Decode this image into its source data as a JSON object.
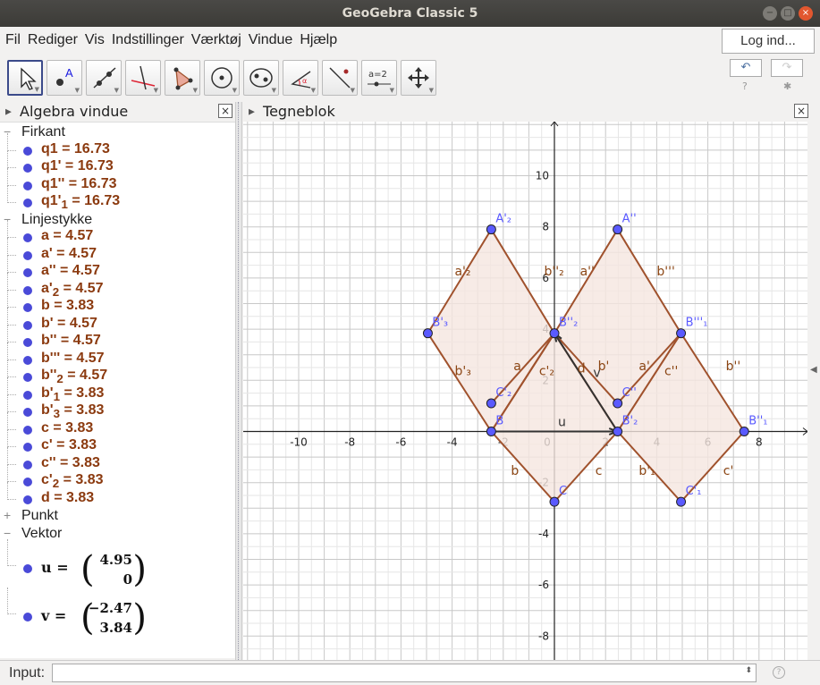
{
  "window": {
    "title": "GeoGebra Classic 5"
  },
  "menu": {
    "items": [
      "Fil",
      "Rediger",
      "Vis",
      "Indstillinger",
      "Værktøj",
      "Vindue",
      "Hjælp"
    ],
    "login": "Log ind..."
  },
  "toolbar": {
    "tools": [
      "move-tool",
      "point-tool",
      "line-tool",
      "perpendicular-tool",
      "polygon-tool",
      "circle-tool",
      "ellipse-tool",
      "angle-tool",
      "reflect-tool",
      "slider-tool",
      "move-view-tool"
    ],
    "slider_label": "a=2"
  },
  "algebra": {
    "title": "Algebra vindue",
    "categories": [
      {
        "name": "Firkant",
        "items": [
          {
            "html": "q1 = 16.73"
          },
          {
            "html": "q1' = 16.73"
          },
          {
            "html": "q1'' = 16.73"
          },
          {
            "html": "q1'<sub>1</sub> = 16.73"
          }
        ]
      },
      {
        "name": "Linjestykke",
        "items": [
          {
            "html": "a = 4.57"
          },
          {
            "html": "a' = 4.57"
          },
          {
            "html": "a'' = 4.57"
          },
          {
            "html": "a'<sub>2</sub> = 4.57"
          },
          {
            "html": "b = 3.83"
          },
          {
            "html": "b' = 4.57"
          },
          {
            "html": "b'' = 4.57"
          },
          {
            "html": "b''' = 4.57"
          },
          {
            "html": "b''<sub>2</sub> = 4.57"
          },
          {
            "html": "b'<sub>1</sub> = 3.83"
          },
          {
            "html": "b'<sub>3</sub> = 3.83"
          },
          {
            "html": "c = 3.83"
          },
          {
            "html": "c' = 3.83"
          },
          {
            "html": "c'' = 3.83"
          },
          {
            "html": "c'<sub>2</sub> = 3.83"
          },
          {
            "html": "d = 3.83"
          }
        ]
      },
      {
        "name": "Punkt",
        "items": []
      },
      {
        "name": "Vektor",
        "items": []
      }
    ],
    "vectors": [
      {
        "name": "u",
        "x": "4.95",
        "y": "0"
      },
      {
        "name": "v",
        "x": "−2.47",
        "y": "3.84"
      }
    ]
  },
  "graphics": {
    "title": "Tegneblok",
    "x_ticks": [
      -10,
      -8,
      -6,
      -4,
      -2,
      0,
      2,
      4,
      6,
      8
    ],
    "y_ticks": [
      -8,
      -6,
      -4,
      -2,
      2,
      4,
      6,
      8,
      10
    ],
    "fill_color": "#f5e6e0",
    "edge_color": "#a0522d",
    "point_color": "#5a5aff",
    "polygons": [
      [
        [
          -2.47,
          0
        ],
        [
          0,
          -2.75
        ],
        [
          2.47,
          0
        ],
        [
          0,
          3.84
        ]
      ],
      [
        [
          -2.47,
          0
        ],
        [
          0,
          3.84
        ],
        [
          -2.47,
          7.9
        ],
        [
          -4.95,
          3.84
        ]
      ],
      [
        [
          2.47,
          0
        ],
        [
          4.95,
          3.84
        ],
        [
          2.47,
          7.9
        ],
        [
          0,
          3.84
        ]
      ],
      [
        [
          2.47,
          0
        ],
        [
          4.95,
          -2.75
        ],
        [
          7.42,
          0
        ],
        [
          4.95,
          3.84
        ]
      ]
    ],
    "segments": [
      [
        [
          -2.47,
          0
        ],
        [
          0,
          3.84
        ]
      ],
      [
        [
          -2.47,
          1.1
        ],
        [
          0,
          3.84
        ]
      ],
      [
        [
          2.47,
          1.1
        ],
        [
          0,
          3.84
        ]
      ],
      [
        [
          2.47,
          1.1
        ],
        [
          4.95,
          3.84
        ]
      ]
    ],
    "points": [
      {
        "x": -2.47,
        "y": 0,
        "label": "B"
      },
      {
        "x": 0,
        "y": -2.75,
        "label": "C"
      },
      {
        "x": 2.47,
        "y": 0,
        "label": "B'₂"
      },
      {
        "x": 0,
        "y": 3.84,
        "label": "B''₂"
      },
      {
        "x": -2.47,
        "y": 7.9,
        "label": "A'₂"
      },
      {
        "x": -4.95,
        "y": 3.84,
        "label": "B'₃"
      },
      {
        "x": 2.47,
        "y": 7.9,
        "label": "A''"
      },
      {
        "x": 4.95,
        "y": 3.84,
        "label": "B'''₁"
      },
      {
        "x": 7.42,
        "y": 0,
        "label": "B''₁"
      },
      {
        "x": 4.95,
        "y": -2.75,
        "label": "C'₁"
      },
      {
        "x": -2.47,
        "y": 1.1,
        "label": "C'₂"
      },
      {
        "x": 2.47,
        "y": 1.1,
        "label": "C''"
      }
    ],
    "vectors": [
      {
        "from": [
          -2.47,
          0
        ],
        "to": [
          2.47,
          0
        ],
        "label": "u"
      },
      {
        "from": [
          2.47,
          0
        ],
        "to": [
          0,
          3.84
        ],
        "label": "v"
      }
    ],
    "edge_labels": [
      {
        "x": -3.9,
        "y": 6.1,
        "text": "a'₂"
      },
      {
        "x": -0.4,
        "y": 6.1,
        "text": "b''₂"
      },
      {
        "x": 1.0,
        "y": 6.1,
        "text": "a''"
      },
      {
        "x": 4.0,
        "y": 6.1,
        "text": "b'''"
      },
      {
        "x": -3.9,
        "y": 2.2,
        "text": "b'₃"
      },
      {
        "x": -1.6,
        "y": 2.4,
        "text": "a"
      },
      {
        "x": -0.6,
        "y": 2.2,
        "text": "c'₂"
      },
      {
        "x": 0.9,
        "y": 2.3,
        "text": "d"
      },
      {
        "x": 1.7,
        "y": 2.4,
        "text": "b'"
      },
      {
        "x": 3.3,
        "y": 2.4,
        "text": "a'"
      },
      {
        "x": 4.3,
        "y": 2.2,
        "text": "c''"
      },
      {
        "x": 6.7,
        "y": 2.4,
        "text": "b''"
      },
      {
        "x": -1.7,
        "y": -1.7,
        "text": "b"
      },
      {
        "x": 1.6,
        "y": -1.7,
        "text": "c"
      },
      {
        "x": 3.3,
        "y": -1.7,
        "text": "b'₁"
      },
      {
        "x": 6.6,
        "y": -1.7,
        "text": "c'"
      }
    ]
  },
  "input": {
    "label": "Input:"
  }
}
